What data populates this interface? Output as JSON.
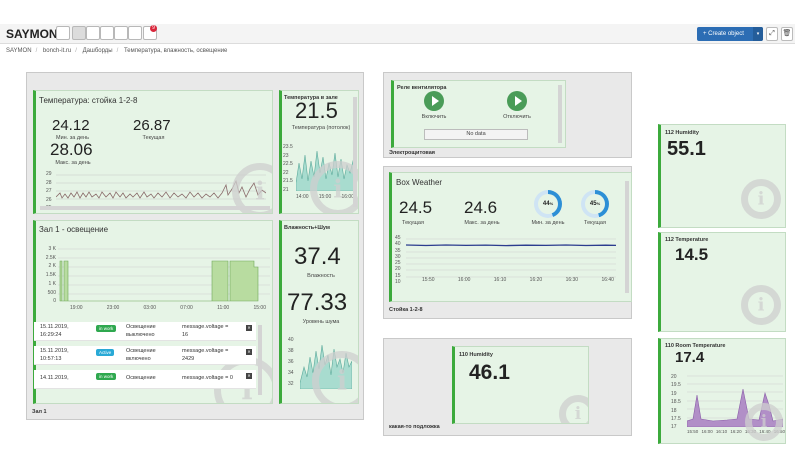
{
  "app": {
    "logo": "SAYMON",
    "create_label": "+ Create object",
    "create_caret": "▾",
    "bell_count": "9"
  },
  "breadcrumb": [
    "SAYMON",
    "bonch-it.ru",
    "Дашборды",
    "Температура, влажность, освещение"
  ],
  "groups": {
    "zal1": "Зал 1",
    "elektro": "Электрощитовая",
    "stoika": "Стойка 1-2-8",
    "kakaya": "какая-то подложка"
  },
  "temp_stoika": {
    "title": "Температура: стойка 1-2-8",
    "min_val": "24.12",
    "min_label": "Мин. за день",
    "cur_val": "26.87",
    "cur_label": "Текущая",
    "max_val": "28.06",
    "max_label": "Макс. за день",
    "y_ticks": [
      "29",
      "28",
      "27",
      "26",
      "25",
      "24"
    ]
  },
  "temp_zal": {
    "title": "Температура в зале",
    "value": "21.5",
    "label": "Температура (потолок)",
    "y_ticks": [
      "23.5",
      "23",
      "22.5",
      "22",
      "21.5",
      "21"
    ],
    "x_ticks": [
      "14:00",
      "15:00",
      "16:00"
    ]
  },
  "osveschenie": {
    "title": "Зал 1 - освещение",
    "y_ticks": [
      "3 K",
      "2.5K",
      "2 K",
      "1.5K",
      "1 K",
      "500",
      "0"
    ],
    "x_ticks": [
      "19:00",
      "23:00",
      "03:00",
      "07:00",
      "11:00",
      "15:00"
    ],
    "events": [
      {
        "date": "15.11.2019,",
        "time": "16:29:24",
        "status": "in work",
        "color": "#2fa84f",
        "desc1": "Освещение",
        "desc2": "выключено",
        "msg1": "message.voltage =",
        "msg2": "16"
      },
      {
        "date": "15.11.2019,",
        "time": "10:57:13",
        "status": "Active",
        "color": "#29a9d6",
        "desc1": "Освещение",
        "desc2": "включено",
        "msg1": "message.voltage =",
        "msg2": "2429"
      },
      {
        "date": "14.11.2019,",
        "time": "",
        "status": "in work",
        "color": "#2fa84f",
        "desc1": "Освещение",
        "desc2": "",
        "msg1": "message.voltage = 0",
        "msg2": ""
      }
    ]
  },
  "vlaz_shum": {
    "title": "Влажность+Шум",
    "hum_val": "37.4",
    "hum_label": "Влажность",
    "noise_val": "77.33",
    "noise_label": "Уровень шума",
    "y_ticks": [
      "40",
      "38",
      "36",
      "34",
      "32"
    ]
  },
  "rele": {
    "title": "Реле вентилятора",
    "on_label": "Включить",
    "off_label": "Отключить",
    "nodata": "No data"
  },
  "box_weather": {
    "title": "Box Weather",
    "cur_val": "24.5",
    "cur_label": "Текущая",
    "max_val": "24.6",
    "max_label": "Макс. за день",
    "min_pct": "44",
    "min_label": "Мин. за день",
    "cur_pct": "45",
    "cur_pct_label": "Текущая",
    "pct_sign": "%",
    "y_ticks": [
      "45",
      "40",
      "35",
      "30",
      "25",
      "20",
      "15",
      "10"
    ],
    "x_ticks": [
      "15:50",
      "16:00",
      "16:10",
      "16:20",
      "16:30",
      "16:40"
    ]
  },
  "hum110": {
    "title": "110 Humidity",
    "value": "46.1"
  },
  "hum112": {
    "title": "112 Humidity",
    "value": "55.1"
  },
  "temp112": {
    "title": "112 Temperature",
    "value": "14.5"
  },
  "room110": {
    "title": "110 Room Temperature",
    "value": "17.4",
    "y_ticks": [
      "20",
      "19.5",
      "19",
      "18.5",
      "18",
      "17.5",
      "17"
    ],
    "x_ticks": [
      "15:50",
      "16:00",
      "16:10",
      "16:20",
      "16:30",
      "16:40",
      "16:50"
    ]
  },
  "colors": {
    "accent": "#3caa3c",
    "widget_bg": "#e6f4e6",
    "create": "#2c6db4",
    "chart_line": "#2b3d8f",
    "room_area": "#b18fc7"
  }
}
